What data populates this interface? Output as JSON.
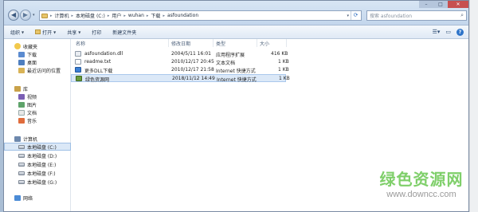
{
  "address_bar": {
    "crumbs": [
      "计算机",
      "本地磁盘 (C:)",
      "用户",
      "wuhan",
      "下载",
      "asfoundation"
    ]
  },
  "search": {
    "placeholder": "搜索 asfoundation"
  },
  "toolbar": {
    "organize": "组织",
    "open": "打开",
    "share": "共享",
    "print": "打印",
    "new_folder": "新建文件夹"
  },
  "navpane": {
    "favorites": "收藏夹",
    "downloads": "下载",
    "desktop": "桌面",
    "recent": "最近访问的位置",
    "libraries": "库",
    "videos": "视频",
    "pictures": "图片",
    "documents": "文档",
    "music": "音乐",
    "computer": "计算机",
    "drive_c": "本地磁盘 (C:)",
    "drive_d": "本地磁盘 (D:)",
    "drive_e": "本地磁盘 (E:)",
    "drive_f": "本地磁盘 (F:)",
    "drive_g": "本地磁盘 (G:)",
    "network": "网络"
  },
  "columns": {
    "name": "名称",
    "modified": "修改日期",
    "type": "类型",
    "size": "大小"
  },
  "files": [
    {
      "name": "asfoundation.dll",
      "modified": "2004/5/11 16:01",
      "type": "应用程序扩展",
      "size": "416 KB",
      "icon": "dll-icon"
    },
    {
      "name": "readme.txt",
      "modified": "2010/12/17 20:45",
      "type": "文本文档",
      "size": "1 KB",
      "icon": "txt-icon"
    },
    {
      "name": "更多DLL下载",
      "modified": "2010/12/17 21:58",
      "type": "Internet 快捷方式",
      "size": "1 KB",
      "icon": "url-icon"
    },
    {
      "name": "绿色资源网",
      "modified": "2018/11/12 14:49",
      "type": "Internet 快捷方式",
      "size": "1 KB",
      "icon": "url-icon"
    }
  ],
  "watermark": {
    "title": "绿色资源网",
    "url": "www.downcc.com"
  }
}
